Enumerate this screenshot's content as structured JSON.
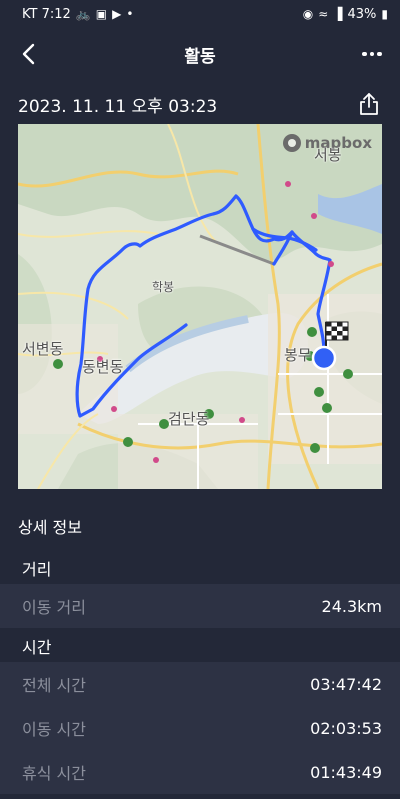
{
  "status_bar": {
    "carrier_time": "KT 7:12",
    "battery": "43%"
  },
  "app_bar": {
    "title": "활동"
  },
  "activity": {
    "date": "2023. 11. 11 오후 03:23"
  },
  "map": {
    "attribution": "mapbox",
    "place_labels": [
      "서변동",
      "동변동",
      "검단동",
      "봉무",
      "학봉",
      "서봉"
    ],
    "route_color": "#2f5bff"
  },
  "details": {
    "section_title": "상세 정보",
    "distance_group": {
      "header": "거리",
      "rows": [
        {
          "label": "이동 거리",
          "value": "24.3km"
        }
      ]
    },
    "time_group": {
      "header": "시간",
      "rows": [
        {
          "label": "전체 시간",
          "value": "03:47:42"
        },
        {
          "label": "이동 시간",
          "value": "02:03:53"
        },
        {
          "label": "휴식 시간",
          "value": "01:43:49"
        }
      ]
    }
  }
}
